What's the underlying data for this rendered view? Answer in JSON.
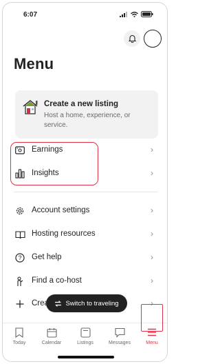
{
  "status_bar": {
    "time": "6:07"
  },
  "header": {
    "title": "Menu"
  },
  "create_listing": {
    "title": "Create a new listing",
    "subtitle": "Host a home, experience, or service."
  },
  "menu_items": [
    {
      "label": "Earnings",
      "icon": "earnings-icon"
    },
    {
      "label": "Insights",
      "icon": "insights-icon"
    },
    {
      "label": "Account settings",
      "icon": "gear-icon"
    },
    {
      "label": "Hosting resources",
      "icon": "book-icon"
    },
    {
      "label": "Get help",
      "icon": "help-icon"
    },
    {
      "label": "Find a co-host",
      "icon": "cohost-icon"
    },
    {
      "label": "Crea",
      "icon": "plus-icon"
    }
  ],
  "switch_pill": {
    "label": "Switch to traveling"
  },
  "bottom_nav": [
    {
      "label": "Today",
      "icon": "today-icon"
    },
    {
      "label": "Calendar",
      "icon": "calendar-icon"
    },
    {
      "label": "Listings",
      "icon": "listings-icon"
    },
    {
      "label": "Messages",
      "icon": "messages-icon"
    },
    {
      "label": "Menu",
      "icon": "menu-icon"
    }
  ],
  "colors": {
    "accent": "#e0334a",
    "text": "#222222",
    "muted": "#6a6a6a"
  }
}
